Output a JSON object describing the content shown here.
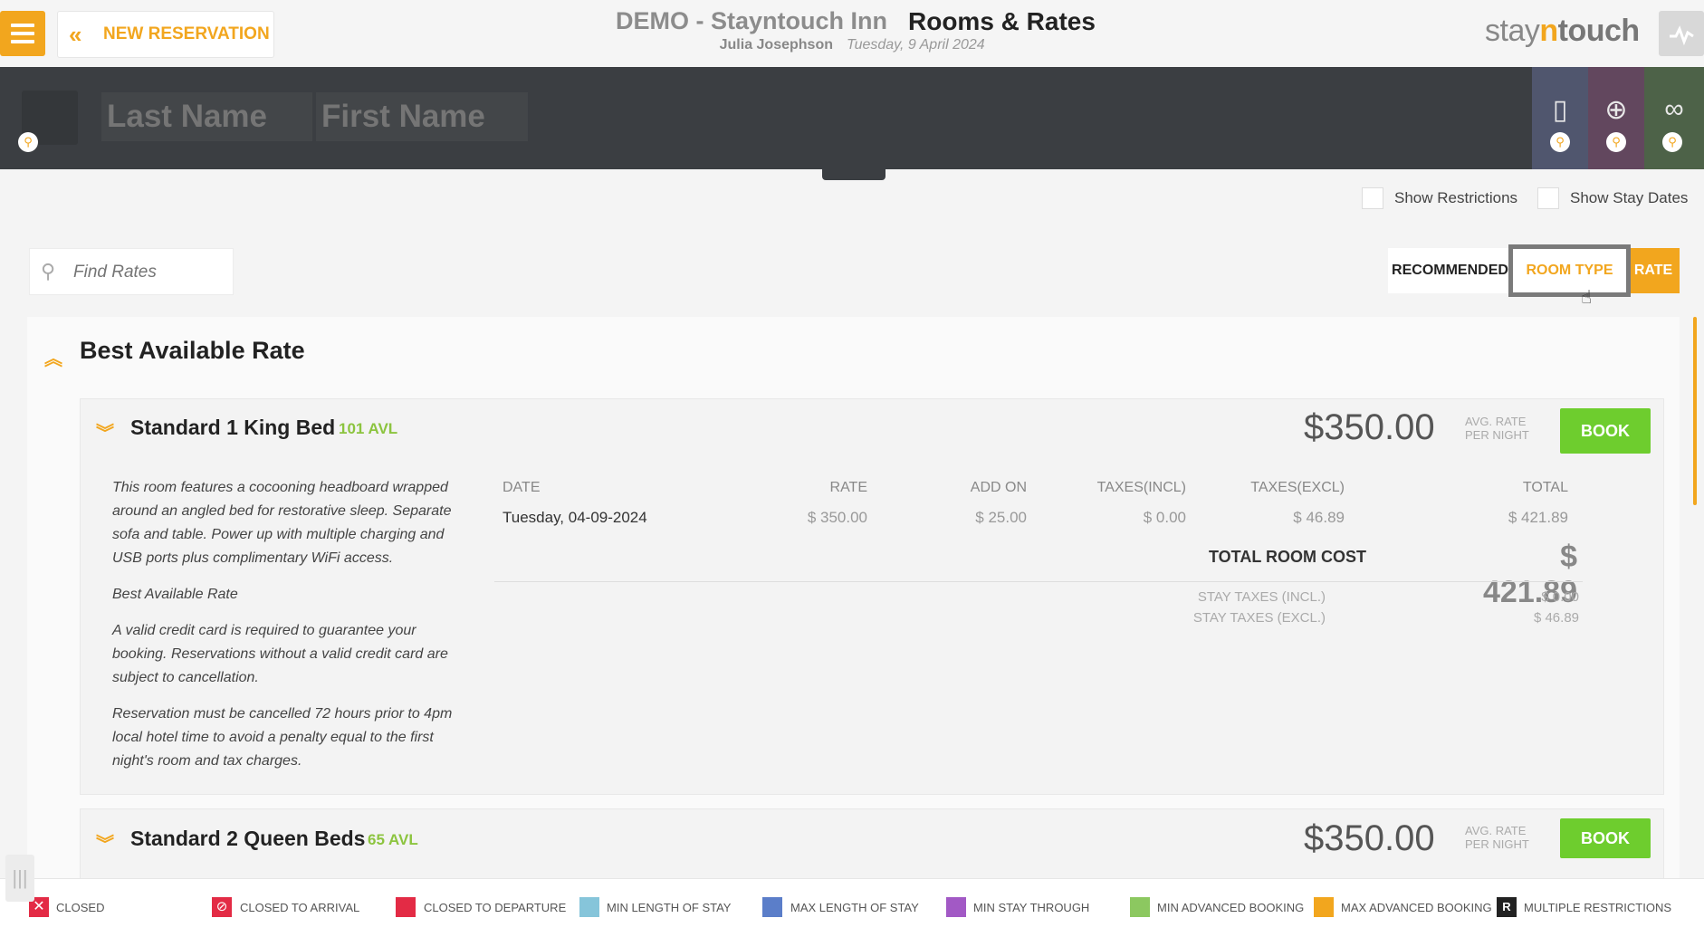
{
  "header": {
    "new_reservation": "NEW RESERVATION",
    "hotel": "DEMO - Stayntouch Inn",
    "title": "Rooms & Rates",
    "user": "Julia Josephson",
    "date": "Tuesday, 9 April 2024",
    "logo_a": "stay",
    "logo_b": "n",
    "logo_c": "touch"
  },
  "search": {
    "last_name_placeholder": "Last Name",
    "first_name_placeholder": "First Name"
  },
  "filters": {
    "show_restrictions": "Show Restrictions",
    "show_stay_dates": "Show Stay Dates"
  },
  "find_rates_placeholder": "Find Rates",
  "view_tabs": {
    "recommended": "RECOMMENDED",
    "room_type": "ROOM TYPE",
    "rate": "RATE",
    "active": "ROOM TYPE"
  },
  "rate_group": {
    "name": "Best Available Rate",
    "rooms": [
      {
        "name": "Standard 1 King Bed",
        "availability": "101 AVL",
        "price": "$350.00",
        "avg_label_1": "AVG. RATE",
        "avg_label_2": "PER NIGHT",
        "book": "BOOK",
        "description": [
          "This room features a cocooning headboard wrapped around an angled bed for restorative sleep. Separate sofa and table. Power up with multiple charging and USB ports plus complimentary WiFi access.",
          "Best Available Rate",
          "A valid credit card is required to guarantee your booking. Reservations without a valid credit card are subject to cancellation.",
          "Reservation must be cancelled 72 hours prior to 4pm local hotel time to avoid a penalty equal to the first night's room and tax charges."
        ],
        "table_headers": [
          "DATE",
          "RATE",
          "ADD ON",
          "TAXES(INCL)",
          "TAXES(EXCL)",
          "TOTAL"
        ],
        "table_rows": [
          [
            "Tuesday, 04-09-2024",
            "$ 350.00",
            "$ 25.00",
            "$ 0.00",
            "$ 46.89",
            "$ 421.89"
          ]
        ],
        "total_room_cost_label": "TOTAL ROOM COST",
        "total_room_cost": "$ 421.89",
        "stay_taxes_incl_label": "STAY TAXES (INCL.)",
        "stay_taxes_incl": "$ 0.00",
        "stay_taxes_excl_label": "STAY TAXES (EXCL.)",
        "stay_taxes_excl": "$ 46.89"
      },
      {
        "name": "Standard 2 Queen Beds",
        "availability": "65 AVL",
        "price": "$350.00",
        "avg_label_1": "AVG. RATE",
        "avg_label_2": "PER NIGHT",
        "book": "BOOK"
      }
    ]
  },
  "legend": [
    {
      "label": "CLOSED",
      "color": "#e32b45"
    },
    {
      "label": "CLOSED TO ARRIVAL",
      "color": "#e32b45"
    },
    {
      "label": "CLOSED TO DEPARTURE",
      "color": "#e32b45"
    },
    {
      "label": "MIN LENGTH OF STAY",
      "color": "#86c5da"
    },
    {
      "label": "MAX LENGTH OF STAY",
      "color": "#5b7ec9"
    },
    {
      "label": "MIN STAY THROUGH",
      "color": "#a259c5"
    },
    {
      "label": "MIN ADVANCED BOOKING",
      "color": "#8cc860"
    },
    {
      "label": "MAX ADVANCED BOOKING",
      "color": "#f2a61e"
    },
    {
      "label": "MULTIPLE RESTRICTIONS",
      "color": "#222222",
      "glyph": "R"
    }
  ],
  "colors": {
    "accent": "#f2a61e",
    "book": "#6ecd2e",
    "availability": "#8cc43f",
    "band": "#3b3e42"
  }
}
